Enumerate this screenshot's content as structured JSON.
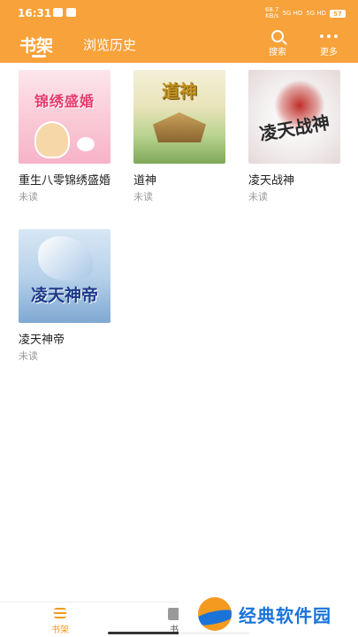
{
  "status_bar": {
    "time": "16:31",
    "net_speed_value": "68.7",
    "net_speed_unit": "KB/s",
    "signal_1": "5G HD",
    "signal_2": "5G HD",
    "battery": "57"
  },
  "header": {
    "tab_shelf": "书架",
    "tab_history": "浏览历史",
    "search_label": "搜索",
    "more_label": "更多"
  },
  "books": [
    {
      "cover_title": "锦绣盛婚",
      "title": "重生八零锦绣盛婚",
      "status": "未读"
    },
    {
      "cover_title": "道神",
      "title": "道神",
      "status": "未读"
    },
    {
      "cover_title": "凌天战神",
      "title": "凌天战神",
      "status": "未读"
    },
    {
      "cover_title": "凌天神帝",
      "title": "凌天神帝",
      "status": "未读"
    }
  ],
  "bottom_nav": {
    "shelf_label": "书架",
    "store_label": "书"
  },
  "watermark": {
    "text": "经典软件园"
  },
  "colors": {
    "accent": "#f7a23a",
    "nav_active": "#f39a1f",
    "watermark_blue": "#1a73d9"
  }
}
